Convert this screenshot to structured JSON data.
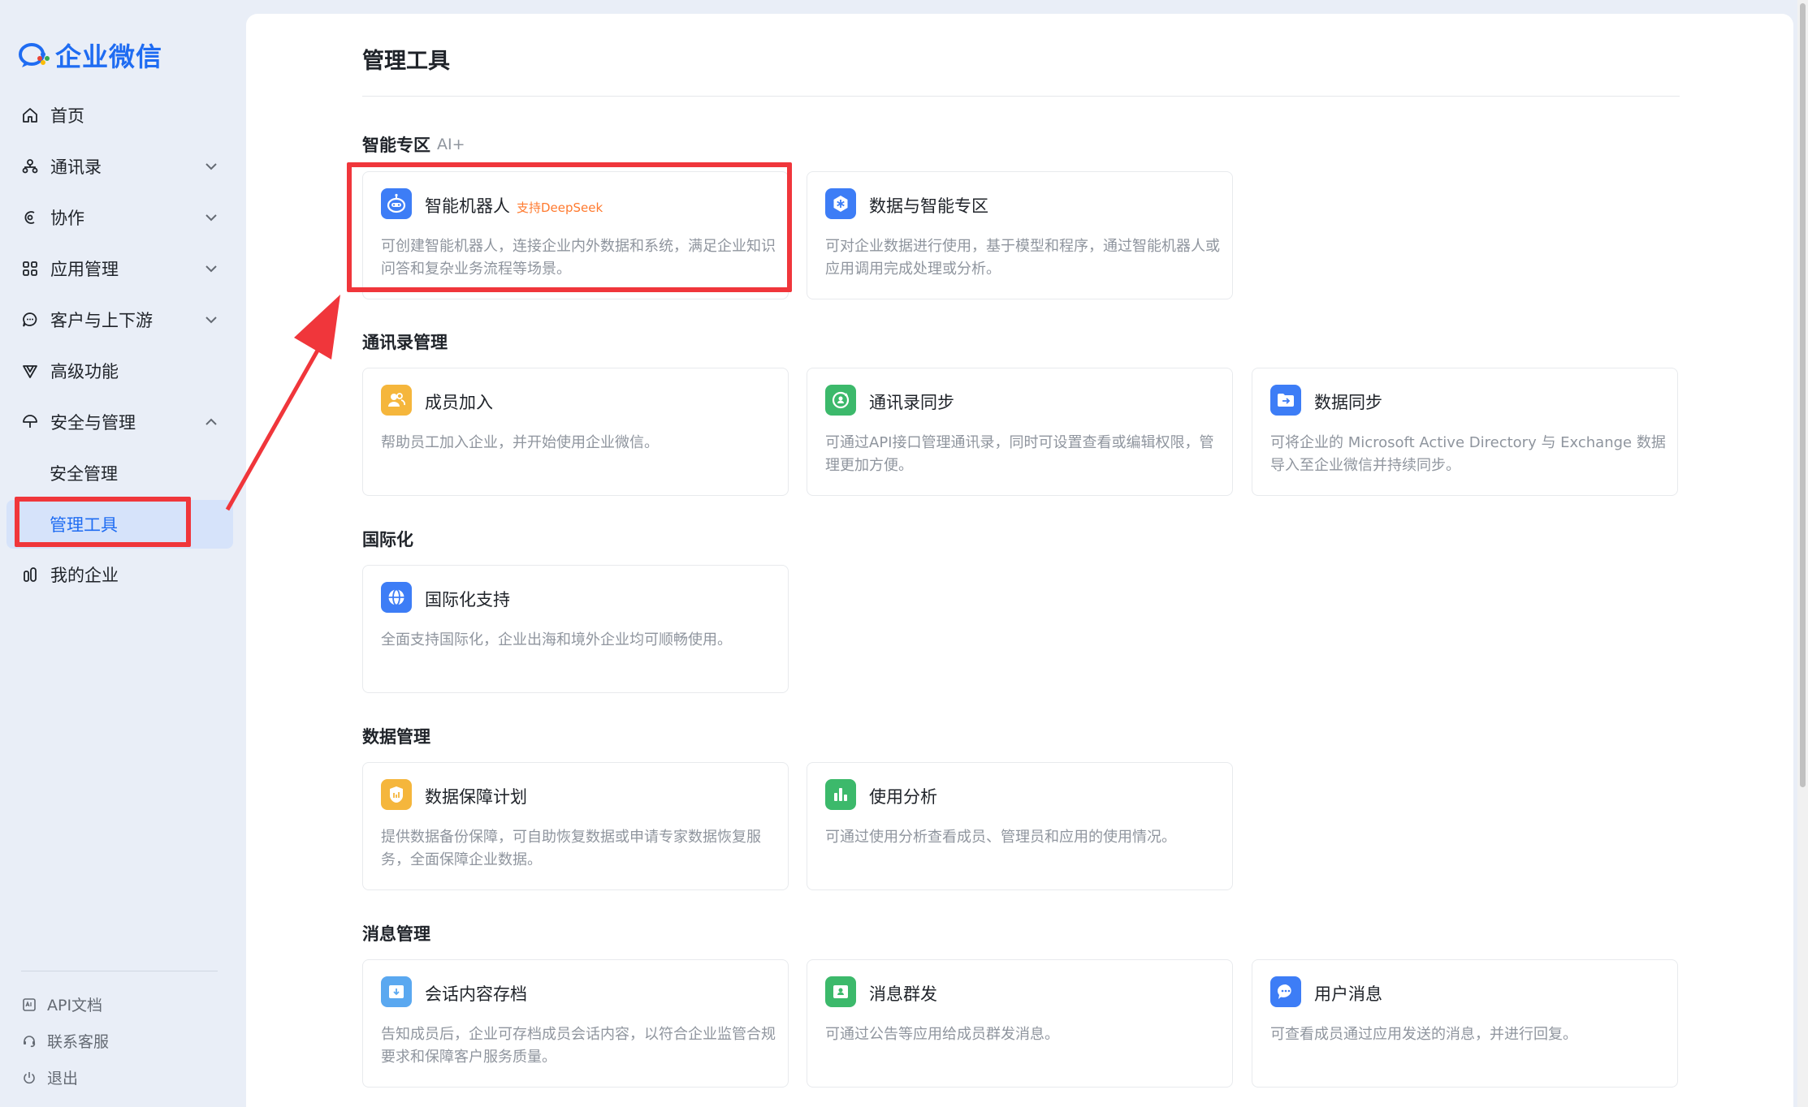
{
  "app": {
    "logo_text": "企业微信"
  },
  "sidebar": {
    "items": [
      {
        "label": "首页",
        "icon": "home-icon"
      },
      {
        "label": "通讯录",
        "icon": "org-icon",
        "expandable": true
      },
      {
        "label": "协作",
        "icon": "collab-icon",
        "expandable": true
      },
      {
        "label": "应用管理",
        "icon": "apps-icon",
        "expandable": true
      },
      {
        "label": "客户与上下游",
        "icon": "chat-icon",
        "expandable": true
      },
      {
        "label": "高级功能",
        "icon": "diamond-icon"
      },
      {
        "label": "安全与管理",
        "icon": "umbrella-icon",
        "expanded": true
      },
      {
        "label": "安全管理",
        "sub": true
      },
      {
        "label": "管理工具",
        "sub": true,
        "active": true
      },
      {
        "label": "我的企业",
        "icon": "building-icon"
      }
    ],
    "bottom": [
      {
        "label": "API文档",
        "icon": "api-doc-icon"
      },
      {
        "label": "联系客服",
        "icon": "headset-icon"
      },
      {
        "label": "退出",
        "icon": "power-icon"
      }
    ]
  },
  "main": {
    "title": "管理工具",
    "sections": [
      {
        "title": "智能专区",
        "tag": "AI+"
      },
      {
        "title": "通讯录管理"
      },
      {
        "title": "国际化"
      },
      {
        "title": "数据管理"
      },
      {
        "title": "消息管理"
      }
    ],
    "cards": {
      "robot": {
        "title": "智能机器人",
        "badge": "支持DeepSeek",
        "desc": "可创建智能机器人，连接企业内外数据和系统，满足企业知识问答和复杂业务流程等场景。"
      },
      "data_ai": {
        "title": "数据与智能专区",
        "desc": "可对企业数据进行使用，基于模型和程序，通过智能机器人或应用调用完成处理或分析。"
      },
      "member_join": {
        "title": "成员加入",
        "desc": "帮助员工加入企业，并开始使用企业微信。"
      },
      "contact_sync": {
        "title": "通讯录同步",
        "desc": "可通过API接口管理通讯录，同时可设置查看或编辑权限，管理更加方便。"
      },
      "data_sync": {
        "title": "数据同步",
        "desc": "可将企业的 Microsoft Active Directory 与 Exchange 数据导入至企业微信并持续同步。"
      },
      "intl": {
        "title": "国际化支持",
        "desc": "全面支持国际化，企业出海和境外企业均可顺畅使用。"
      },
      "data_protect": {
        "title": "数据保障计划",
        "desc": "提供数据备份保障，可自助恢复数据或申请专家数据恢复服务，全面保障企业数据。"
      },
      "usage": {
        "title": "使用分析",
        "desc": "可通过使用分析查看成员、管理员和应用的使用情况。"
      },
      "archive": {
        "title": "会话内容存档",
        "desc": "告知成员后，企业可存档成员会话内容，以符合企业监管合规要求和保障客户服务质量。"
      },
      "broadcast": {
        "title": "消息群发",
        "desc": "可通过公告等应用给成员群发消息。"
      },
      "user_msg": {
        "title": "用户消息",
        "desc": "可查看成员通过应用发送的消息，并进行回复。"
      }
    }
  },
  "colors": {
    "accent": "#1f6cf2",
    "highlight": "#f0363b",
    "badge": "#ff7a2f"
  }
}
